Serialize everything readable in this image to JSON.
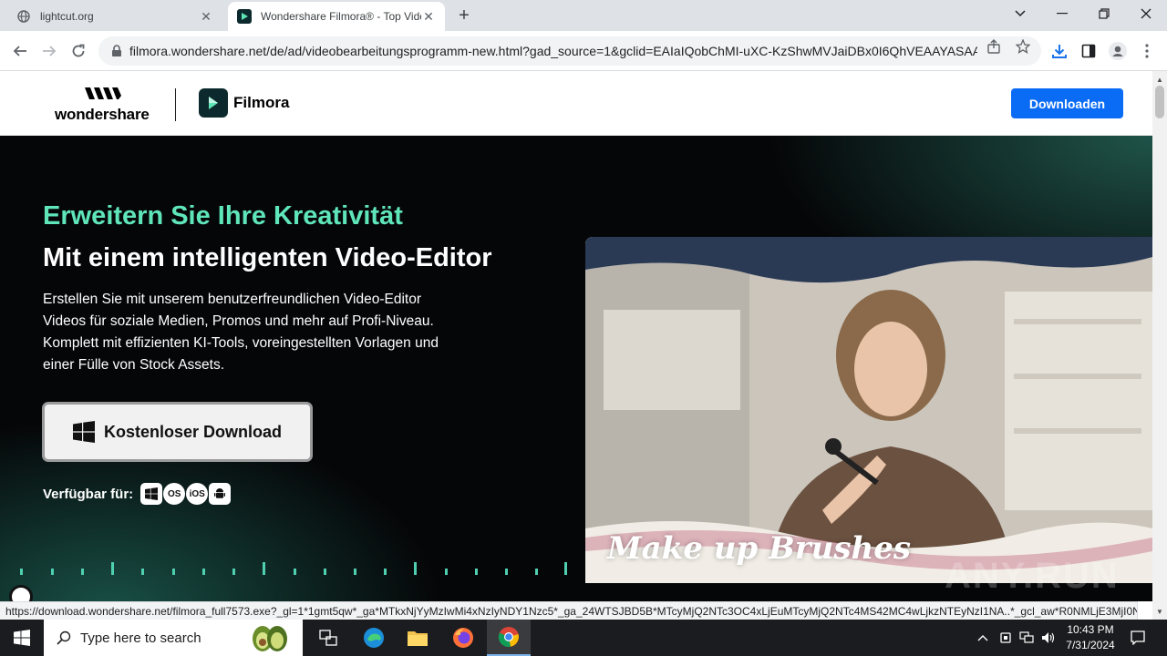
{
  "browser": {
    "tabs": [
      {
        "title": "lightcut.org",
        "active": false
      },
      {
        "title": "Wondershare Filmora® - Top Video",
        "active": true
      }
    ],
    "url": "filmora.wondershare.net/de/ad/videobearbeitungsprogramm-new.html?gad_source=1&gclid=EAIaIQobChMI-uXC-KzShwMVJaiDBx0I6QhVEAAYASAA...",
    "status_url": "https://download.wondershare.net/filmora_full7573.exe?_gl=1*1gmt5qw*_ga*MTkxNjYyMzIwMi4xNzIyNDY1Nzc5*_ga_24WTSJBD5B*MTcyMjQ2NTc3OC4xLjEuMTcyMjQ2NTc4MS42MC4wLjkzNTEyNzI1NA..*_gcl_aw*R0NMLjE3MjI0NjU3..."
  },
  "header": {
    "wondershare_label": "wondershare",
    "filmora_label": "Filmora",
    "download_button": "Downloaden"
  },
  "hero": {
    "kicker": "Erweitern Sie Ihre Kreativität",
    "title": "Mit einem intelligenten Video-Editor",
    "description_lines": [
      "Erstellen Sie mit unserem benutzerfreundlichen Video-Editor",
      "Videos für soziale Medien, Promos und mehr auf Profi-Niveau.",
      "Komplett mit effizienten KI-Tools, voreingestellten Vorlagen und",
      "einer Fülle von Stock Assets."
    ],
    "cta_label": "Kostenloser Download",
    "available_label": "Verfügbar für:",
    "platforms": [
      {
        "name": "windows-icon",
        "text": ""
      },
      {
        "name": "macos-icon",
        "text": "OS"
      },
      {
        "name": "ios-icon",
        "text": "iOS"
      },
      {
        "name": "android-icon",
        "text": ""
      }
    ],
    "video_caption": "Make up Brushes"
  },
  "watermark": "ANY.RUN",
  "taskbar": {
    "search_placeholder": "Type here to search",
    "time": "10:43 PM",
    "date": "7/31/2024"
  },
  "colors": {
    "accent_green": "#5fe6b8",
    "download_blue": "#0a6cf5",
    "hero_bg": "#050608"
  }
}
